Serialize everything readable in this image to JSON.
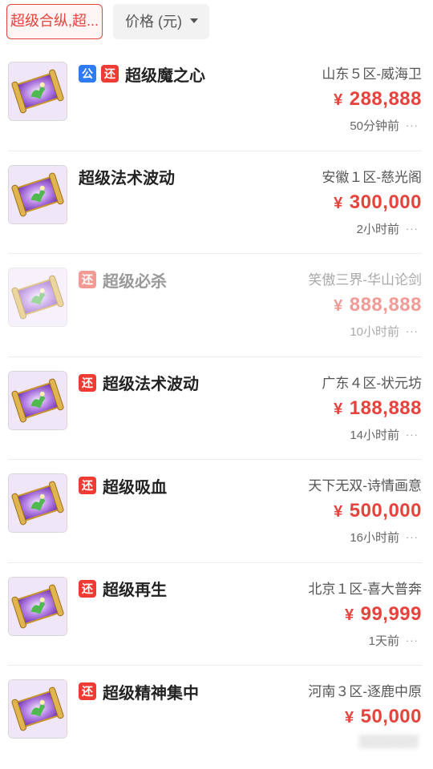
{
  "filters": {
    "search": "超级合纵,超...",
    "price_sort": "价格 (元)"
  },
  "listings": [
    {
      "badges": [
        "公",
        "还"
      ],
      "title": "超级魔之心",
      "server": "山东５区-威海卫",
      "currency": "¥",
      "price": "288,888",
      "time": "50分钟前",
      "more": "···"
    },
    {
      "badges": [],
      "title": "超级法术波动",
      "server": "安徽１区-慈光阁",
      "currency": "¥",
      "price": "300,000",
      "time": "2小时前",
      "more": "···"
    },
    {
      "badges": [
        "还"
      ],
      "title": "超级必杀",
      "server": "笑傲三界-华山论剑",
      "currency": "¥",
      "price": "888,888",
      "time": "10小时前",
      "more": "···"
    },
    {
      "badges": [
        "还"
      ],
      "title": "超级法术波动",
      "server": "广东４区-状元坊",
      "currency": "¥",
      "price": "188,888",
      "time": "14小时前",
      "more": "···"
    },
    {
      "badges": [
        "还"
      ],
      "title": "超级吸血",
      "server": "天下无双-诗情画意",
      "currency": "¥",
      "price": "500,000",
      "time": "16小时前",
      "more": "···"
    },
    {
      "badges": [
        "还"
      ],
      "title": "超级再生",
      "server": "北京１区-喜大普奔",
      "currency": "¥",
      "price": "99,999",
      "time": "1天前",
      "more": "···"
    },
    {
      "badges": [
        "还"
      ],
      "title": "超级精神集中",
      "server": "河南３区-逐鹿中原",
      "currency": "¥",
      "price": "50,000",
      "time": "",
      "more": ""
    }
  ],
  "colors": {
    "accent_red": "#e8423c",
    "badge_blue": "#2f7bf6"
  }
}
